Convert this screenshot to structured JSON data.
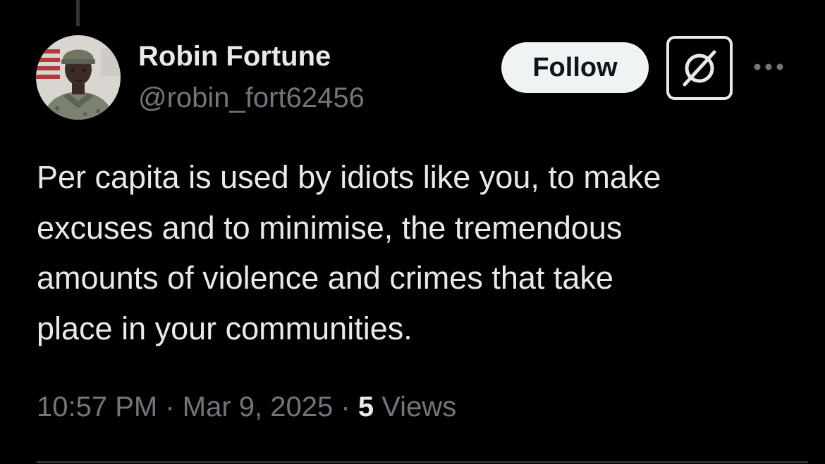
{
  "author": {
    "name": "Robin Fortune",
    "handle": "@robin_fort62456",
    "avatar_icon": "profile-photo-soldier"
  },
  "actions": {
    "follow_label": "Follow",
    "grok_icon": "grok-icon",
    "more_icon": "more-dots-icon"
  },
  "post": {
    "text": "Per capita is used by idiots like you, to make\nexcuses and to minimise,  the tremendous\namounts of violence and crimes that take\nplace in your communities."
  },
  "meta": {
    "time": "10:57 PM",
    "separator": "·",
    "date": "Mar 9, 2025",
    "views_count": "5",
    "views_label": "Views"
  },
  "colors": {
    "background": "#000000",
    "primary_text": "#e7e9ea",
    "secondary_text": "#71767b",
    "follow_bg": "#eff3f4",
    "follow_text": "#0f1419"
  }
}
